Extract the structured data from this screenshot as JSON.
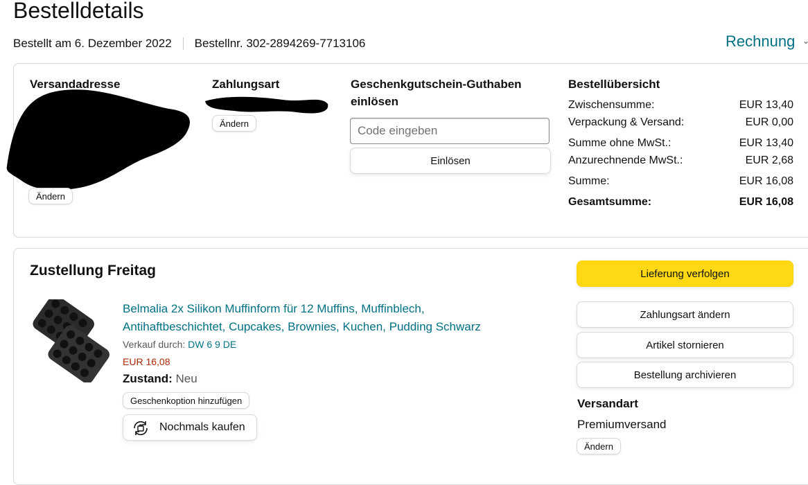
{
  "page": {
    "title": "Bestelldetails",
    "order_date": "Bestellt am 6. Dezember 2022",
    "order_number": "Bestellnr. 302-2894269-7713106",
    "invoice_label": "Rechnung",
    "invoice_chevron": "⌄"
  },
  "summary": {
    "shipping_address": {
      "heading": "Versandadresse",
      "change_label": "Ändern"
    },
    "payment": {
      "heading": "Zahlungsart",
      "change_label": "Ändern"
    },
    "gift_card": {
      "heading_line1": "Geschenkgutschein-Guthaben",
      "heading_line2": "einlösen",
      "placeholder": "Code eingeben",
      "redeem_label": "Einlösen"
    },
    "order_summary": {
      "heading": "Bestellübersicht",
      "rows": [
        {
          "label": "Zwischensumme:",
          "value": "EUR 13,40"
        },
        {
          "label": "Verpackung & Versand:",
          "value": "EUR 0,00"
        },
        {
          "label": "Summe ohne MwSt.:",
          "value": "EUR 13,40"
        },
        {
          "label": "Anzurechnende MwSt.:",
          "value": "EUR 2,68"
        },
        {
          "label": "Summe:",
          "value": "EUR 16,08"
        },
        {
          "label": "Gesamtsumme:",
          "value": "EUR 16,08"
        }
      ]
    }
  },
  "shipment": {
    "heading": "Zustellung Freitag",
    "product": {
      "title_line1": "Belmalia 2x Silikon Muffinform für 12 Muffins, Muffinblech,",
      "title_line2": "Antihaftbeschichtet, Cupcakes, Brownies, Kuchen, Pudding Schwarz",
      "sold_by_label": "Verkauf durch:",
      "seller": "DW 6 9 DE",
      "price": "EUR 16,08",
      "condition_label": "Zustand:",
      "condition_value": "Neu",
      "gift_option_label": "Geschenkoption hinzufügen",
      "buy_again_label": "Nochmals kaufen"
    },
    "actions": {
      "track": "Lieferung verfolgen",
      "change_payment": "Zahlungsart ändern",
      "cancel": "Artikel stornieren",
      "archive": "Bestellung archivieren"
    },
    "shipping_method": {
      "heading": "Versandart",
      "value": "Premiumversand",
      "change_label": "Ändern"
    }
  },
  "colors": {
    "accent": "#007185",
    "primary_button": "#ffd814",
    "price": "#b12704"
  }
}
